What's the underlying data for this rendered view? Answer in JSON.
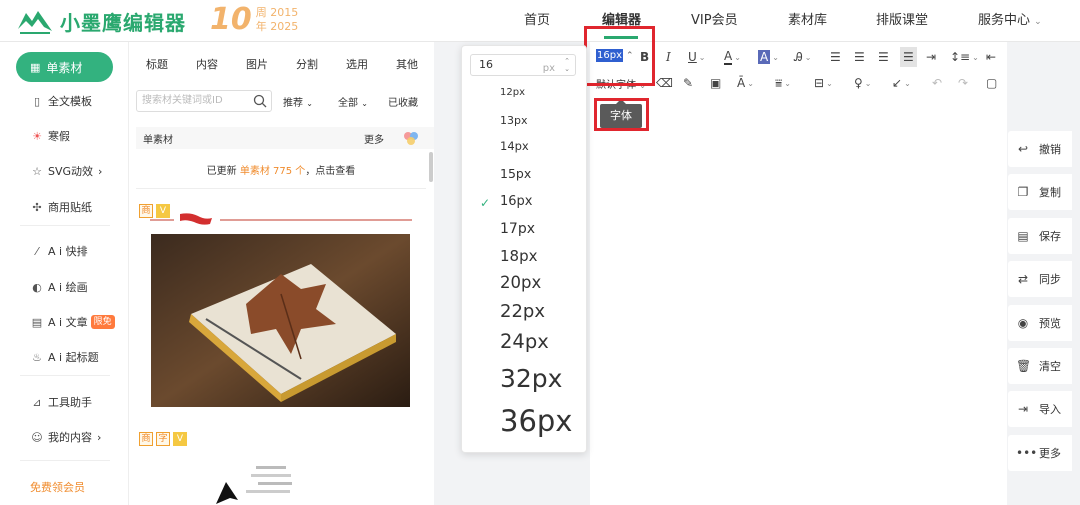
{
  "header": {
    "brand": "小墨鹰编辑器",
    "anniversary": {
      "num": "10",
      "line1": "周 2015",
      "line2": "年 2025"
    },
    "nav": [
      {
        "label": "首页",
        "active": false
      },
      {
        "label": "编辑器",
        "active": true
      },
      {
        "label": "VIP会员",
        "active": false
      },
      {
        "label": "素材库",
        "active": false
      },
      {
        "label": "排版课堂",
        "active": false
      },
      {
        "label": "服务中心",
        "active": false
      }
    ]
  },
  "leftmenu": {
    "active": "单素材",
    "items": [
      {
        "label": "全文模板",
        "icon": "template-icon"
      },
      {
        "label": "寒假",
        "icon": "snow-icon"
      },
      {
        "label": "SVG动效",
        "icon": "star-icon",
        "arrow": "›"
      },
      {
        "label": "商用贴纸",
        "icon": "puzzle-icon"
      },
      {
        "label": "A i 快排",
        "icon": "ai-layout-icon"
      },
      {
        "label": "A i 绘画",
        "icon": "palette-icon"
      },
      {
        "label": "A i 文章",
        "icon": "doc-icon",
        "badge": "限免"
      },
      {
        "label": "A i 起标题",
        "icon": "fire-icon"
      },
      {
        "label": "工具助手",
        "icon": "ruler-icon"
      },
      {
        "label": "我的内容",
        "icon": "user-icon",
        "arrow": "›"
      }
    ],
    "free_member": "免费领会员"
  },
  "material": {
    "tabs": [
      "标题",
      "内容",
      "图片",
      "分割",
      "选用",
      "其他"
    ],
    "search_placeholder": "搜索材关键词或ID",
    "filters": [
      "推荐",
      "全部",
      "已收藏"
    ],
    "section_title": "单素材",
    "more": "更多",
    "update": {
      "pre": "已更新 ",
      "hl": "单素材 775 个",
      "post": "，点击查看"
    },
    "card1_tags": [
      "商",
      "V"
    ],
    "card2_tags": [
      "商",
      "字",
      "V"
    ]
  },
  "fontsize_dropdown": {
    "input_value": "16",
    "unit": "px",
    "options": [
      "12px",
      "13px",
      "14px",
      "15px",
      "16px",
      "17px",
      "18px",
      "20px",
      "22px",
      "24px",
      "32px",
      "36px"
    ],
    "selected": "16px"
  },
  "toolbar": {
    "font_size": "16px",
    "font_family": "默认字体",
    "tooltip": "字体"
  },
  "right_actions": [
    {
      "label": "撤销",
      "icon": "undo-icon"
    },
    {
      "label": "复制",
      "icon": "copy-icon"
    },
    {
      "label": "保存",
      "icon": "save-icon"
    },
    {
      "label": "同步",
      "icon": "sync-icon"
    },
    {
      "label": "预览",
      "icon": "eye-icon"
    },
    {
      "label": "清空",
      "icon": "trash-icon"
    },
    {
      "label": "导入",
      "icon": "import-icon"
    },
    {
      "label": "更多",
      "icon": "more-icon"
    }
  ],
  "colors": {
    "brand": "#2aa86f",
    "accent": "#f08c2e",
    "highlight": "#e0262e"
  }
}
